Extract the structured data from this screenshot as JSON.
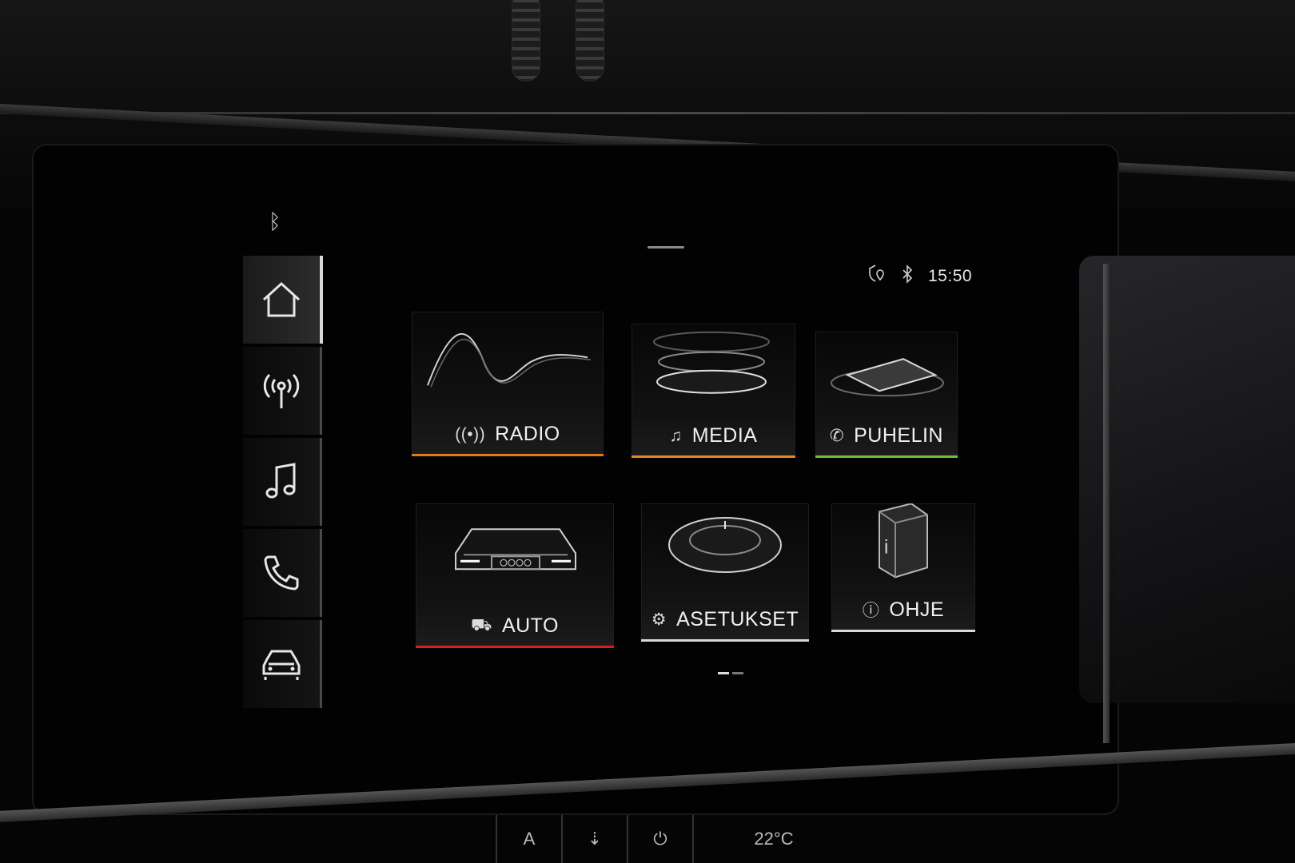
{
  "status_bar": {
    "bluetooth_icon": "bluetooth-icon",
    "location_icon": "location-pin-icon",
    "time": "15:50"
  },
  "sidebar": {
    "items": [
      {
        "icon": "home-icon",
        "active": true
      },
      {
        "icon": "radio-icon",
        "active": false
      },
      {
        "icon": "music-note-icon",
        "active": false
      },
      {
        "icon": "phone-icon",
        "active": false
      },
      {
        "icon": "car-icon",
        "active": false
      }
    ]
  },
  "tiles": [
    {
      "label": "RADIO",
      "icon": "radio-icon",
      "accent": "#e07a1f"
    },
    {
      "label": "MEDIA",
      "icon": "music-note-icon",
      "accent": "#e08a1f"
    },
    {
      "label": "PUHELIN",
      "icon": "phone-icon",
      "accent": "#6abf3a"
    },
    {
      "label": "AUTO",
      "icon": "car-icon",
      "accent": "#d41f1f"
    },
    {
      "label": "ASETUKSET",
      "icon": "gear-icon",
      "accent": "#d8d8d8"
    },
    {
      "label": "OHJE",
      "icon": "info-icon",
      "accent": "#d8d8d8"
    }
  ],
  "pager": {
    "pages": 2,
    "current": 1
  },
  "climate": {
    "items": [
      "A",
      "⇣",
      "⏻"
    ],
    "temp": "22°C"
  },
  "colors": {
    "background": "#050505",
    "text": "#f0f0f0",
    "radio_accent": "#e07a1f",
    "media_accent": "#e08a1f",
    "phone_accent": "#6abf3a",
    "auto_accent": "#d41f1f"
  }
}
